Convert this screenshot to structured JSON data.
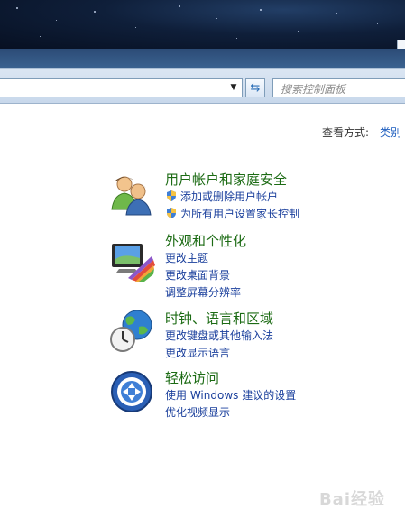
{
  "address_bar": {
    "value": ""
  },
  "search": {
    "placeholder": "搜索控制面板"
  },
  "view_by": {
    "label": "查看方式:",
    "value": "类别"
  },
  "categories": [
    {
      "title": "用户帐户和家庭安全",
      "links": [
        "添加或删除用户帐户",
        "为所有用户设置家长控制"
      ],
      "icon": "users-icon"
    },
    {
      "title": "外观和个性化",
      "links": [
        "更改主题",
        "更改桌面背景",
        "调整屏幕分辨率"
      ],
      "icon": "monitor-paint-icon"
    },
    {
      "title": "时钟、语言和区域",
      "links": [
        "更改键盘或其他输入法",
        "更改显示语言"
      ],
      "icon": "globe-clock-icon"
    },
    {
      "title": "轻松访问",
      "links": [
        "使用 Windows 建议的设置",
        "优化视频显示"
      ],
      "icon": "ease-of-access-icon"
    }
  ],
  "watermark": "Bai经验"
}
